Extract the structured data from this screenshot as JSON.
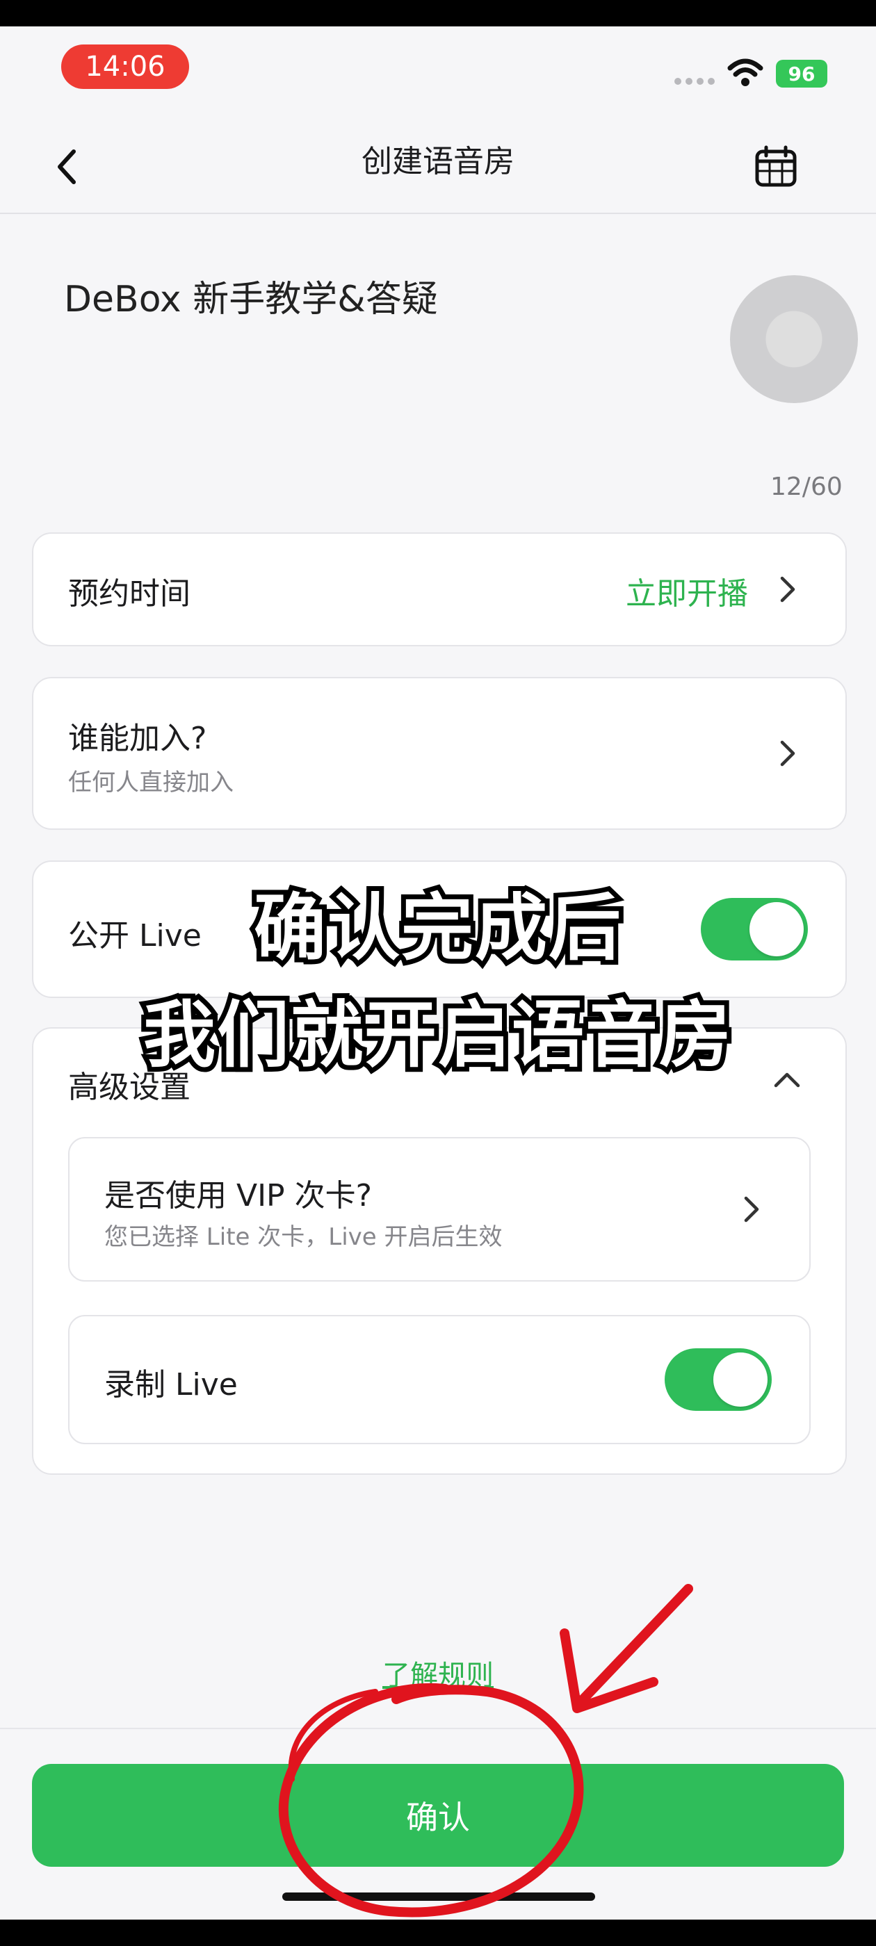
{
  "status_bar": {
    "time": "14:06",
    "battery": "96"
  },
  "header": {
    "title": "创建语音房",
    "back_icon": "chevron-left-icon",
    "calendar_icon": "calendar-icon"
  },
  "room": {
    "name": "DeBox 新手教学&答疑",
    "char_count": "12/60"
  },
  "settings": {
    "schedule_label": "预约时间",
    "schedule_value": "立即开播",
    "who_can_join_label": "谁能加入?",
    "who_can_join_value": "任何人直接加入",
    "public_live_label": "公开 Live",
    "public_live_on": true,
    "advanced_label": "高级设置",
    "vip_card_label": "是否使用 VIP 次卡?",
    "vip_card_hint": "您已选择 Lite 次卡，Live 开启后生效",
    "record_live_label": "录制 Live",
    "record_live_on": true
  },
  "footer": {
    "rules_link": "了解规则",
    "confirm_label": "确认"
  },
  "overlay_caption": {
    "line1": "确认完成后",
    "line2": "我们就开启语音房"
  },
  "colors": {
    "accent": "#2fbd5a",
    "time_pill": "#ee3b33",
    "annotation": "#e0141e"
  }
}
